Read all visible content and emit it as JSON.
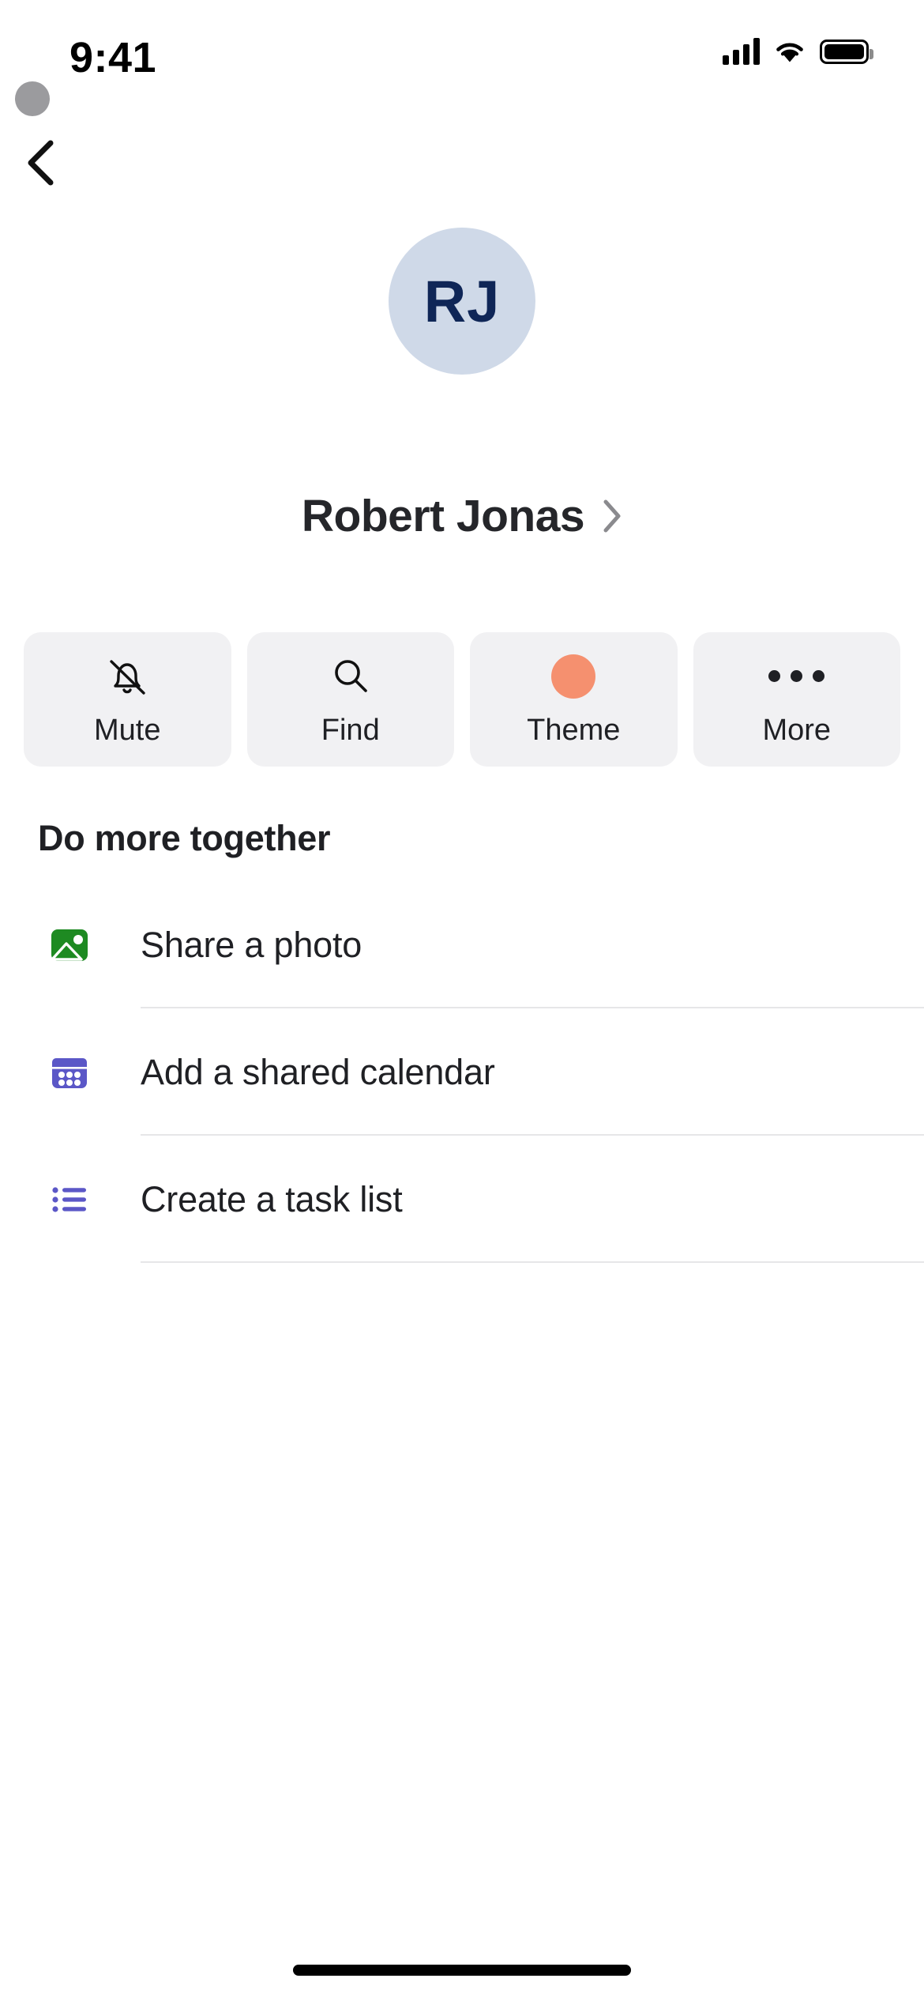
{
  "status_bar": {
    "time": "9:41",
    "cellular_icon": "cellular-signal-icon",
    "wifi_icon": "wifi-icon",
    "battery_icon": "battery-full-icon"
  },
  "nav": {
    "back_icon": "chevron-left-icon",
    "cursor_icon": "cursor-dot"
  },
  "profile": {
    "initials": "RJ",
    "name": "Robert Jonas",
    "chevron_icon": "chevron-right-icon",
    "avatar_bg": "#cfd9e8",
    "avatar_fg": "#0f2657"
  },
  "actions": [
    {
      "label": "Mute",
      "icon": "bell-slash-icon"
    },
    {
      "label": "Find",
      "icon": "search-icon"
    },
    {
      "label": "Theme",
      "icon": "color-swatch-icon",
      "color": "#f5906f"
    },
    {
      "label": "More",
      "icon": "ellipsis-icon"
    }
  ],
  "section": {
    "title": "Do more together"
  },
  "list": [
    {
      "label": "Share a photo",
      "icon": "photo-icon",
      "color": "#1e8a22"
    },
    {
      "label": "Add a shared calendar",
      "icon": "calendar-icon",
      "color": "#5b57c7"
    },
    {
      "label": "Create a task list",
      "icon": "task-list-icon",
      "color": "#5b57c7"
    }
  ],
  "home_indicator": "home-indicator"
}
